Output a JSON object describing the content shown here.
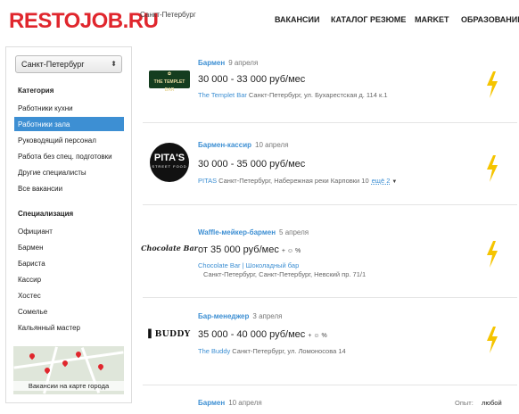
{
  "header": {
    "logo": "RESTOJOB.RU",
    "city": "Санкт-Петербург",
    "nav": [
      "ВАКАНСИИ",
      "КАТАЛОГ РЕЗЮМЕ",
      "MARKET",
      "ОБРАЗОВАНИЕ"
    ]
  },
  "sidebar": {
    "city_select": "Санкт-Петербург",
    "category_heading": "Категория",
    "categories": [
      {
        "label": "Работники кухни",
        "active": false
      },
      {
        "label": "Работники зала",
        "active": true
      },
      {
        "label": "Руководящий персонал",
        "active": false
      },
      {
        "label": "Работа без спец. подготовки",
        "active": false
      },
      {
        "label": "Другие специалисты",
        "active": false
      },
      {
        "label": "Все вакансии",
        "active": false
      }
    ],
    "spec_heading": "Специализация",
    "specializations": [
      "Официант",
      "Бармен",
      "Бариста",
      "Кассир",
      "Хостес",
      "Сомелье",
      "Кальянный мастер"
    ],
    "map_caption": "Вакансии на карте города"
  },
  "jobs": [
    {
      "title": "Бармен",
      "date": "9 апреля",
      "salary": "30 000 - 33 000 руб/мес",
      "tips": "",
      "company": "The Templet Bar",
      "address": "Санкт-Петербург, ул. Бухарестская д. 114 к.1",
      "more": "",
      "logo_text": "THE TEMPLET BAR"
    },
    {
      "title": "Бармен-кассир",
      "date": "10 апреля",
      "salary": "30 000 - 35 000 руб/мес",
      "tips": "",
      "company": "PITAS",
      "address": "Санкт-Петербург, Набережная реки Карповки 10",
      "more": "ещё 2",
      "logo_text": "PITA'S"
    },
    {
      "title": "Waffle-мейкер-бармен",
      "date": "5 апреля",
      "salary": "от 35 000 руб/мес",
      "tips": "+ ☺ %",
      "company": "Chocolate Bar | Шоколадный бар",
      "address": "Санкт-Петербург, Санкт-Петербург, Невский пр. 71/1",
      "more": "",
      "logo_text": "Chocolate Bar"
    },
    {
      "title": "Бар-менеджер",
      "date": "3 апреля",
      "salary": "35 000 - 40 000 руб/мес",
      "tips": "+ ☺ %",
      "company": "The Buddy",
      "address": "Санкт-Петербург, ул. Ломоносова 14",
      "more": "",
      "logo_text": "BUDDY"
    }
  ],
  "last_job": {
    "title": "Бармен",
    "date": "10 апреля",
    "experience_label": "Опыт:",
    "experience_value": "любой"
  },
  "colors": {
    "brand": "#e0262d",
    "link": "#3d8fd3",
    "bolt": "#f5c400"
  }
}
